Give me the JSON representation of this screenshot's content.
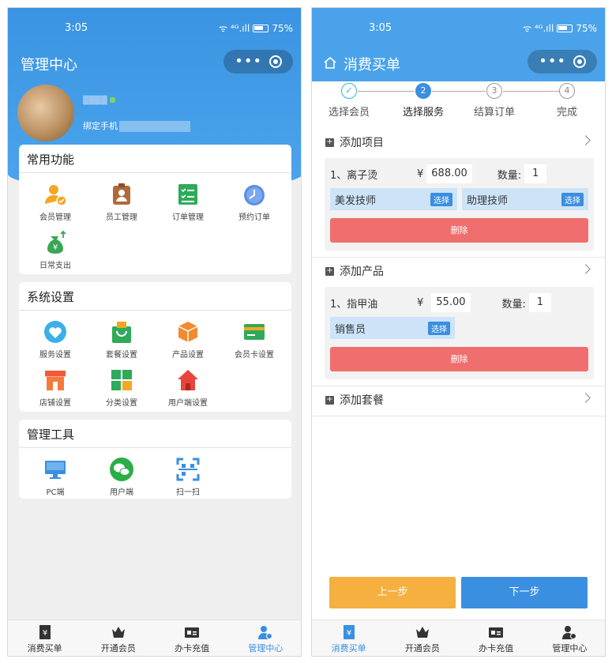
{
  "left": {
    "status": {
      "time": "3:05",
      "battery": "75%",
      "net": "ᯤ ⁴ᴳ.ıll"
    },
    "navbar": {
      "title": "管理中心"
    },
    "profile": {
      "username": "▒▒▒▒",
      "bind_label": "绑定手机"
    },
    "sections": [
      {
        "title": "常用功能",
        "items": [
          {
            "label": "会员管理"
          },
          {
            "label": "员工管理"
          },
          {
            "label": "订单管理"
          },
          {
            "label": "预约订单"
          },
          {
            "label": "日常支出"
          }
        ]
      },
      {
        "title": "系统设置",
        "items": [
          {
            "label": "服务设置"
          },
          {
            "label": "套餐设置"
          },
          {
            "label": "产品设置"
          },
          {
            "label": "会员卡设置"
          },
          {
            "label": "店铺设置"
          },
          {
            "label": "分类设置"
          },
          {
            "label": "用户端设置"
          }
        ]
      },
      {
        "title": "管理工具",
        "items": [
          {
            "label": "PC端"
          },
          {
            "label": "用户端"
          },
          {
            "label": "扫一扫"
          }
        ]
      }
    ],
    "tabs": [
      {
        "label": "消费买单",
        "icon": "receipt-icon"
      },
      {
        "label": "开通会员",
        "icon": "crown-icon"
      },
      {
        "label": "办卡充值",
        "icon": "card-icon"
      },
      {
        "label": "管理中心",
        "icon": "manager-icon",
        "active": true
      }
    ]
  },
  "right": {
    "status": {
      "time": "3:05",
      "battery": "75%",
      "net": "ᯤ ⁴ᴳ.ıll"
    },
    "navbar": {
      "title": "消费买单",
      "icon": "home-icon"
    },
    "steps": [
      {
        "num": "✓",
        "label": "选择会员",
        "state": "done"
      },
      {
        "num": "2",
        "label": "选择服务",
        "state": "current"
      },
      {
        "num": "3",
        "label": "结算订单",
        "state": "todo"
      },
      {
        "num": "4",
        "label": "完成",
        "state": "todo"
      }
    ],
    "add_item": {
      "title": "添加项目",
      "item": {
        "name": "1、离子烫",
        "currency": "¥",
        "price": "688.00",
        "qty_label": "数量:",
        "qty": "1"
      },
      "staff": [
        {
          "role": "美发技师",
          "btn": "选择"
        },
        {
          "role": "助理技师",
          "btn": "选择"
        }
      ],
      "delete": "删除"
    },
    "add_product": {
      "title": "添加产品",
      "item": {
        "name": "1、指甲油",
        "currency": "¥",
        "price": "55.00",
        "qty_label": "数量:",
        "qty": "1"
      },
      "staff": [
        {
          "role": "销售员",
          "btn": "选择"
        }
      ],
      "delete": "删除"
    },
    "add_package": {
      "title": "添加套餐"
    },
    "prev": "上一步",
    "next": "下一步",
    "tabs": [
      {
        "label": "消费买单",
        "icon": "receipt-icon",
        "active": true
      },
      {
        "label": "开通会员",
        "icon": "crown-icon"
      },
      {
        "label": "办卡充值",
        "icon": "card-icon"
      },
      {
        "label": "管理中心",
        "icon": "manager-icon"
      }
    ]
  },
  "colors": {
    "primary": "#4aa3ea",
    "danger": "#f06e6e",
    "prev": "#f5b040",
    "next": "#3a8fe0",
    "chip": "#cde4f8"
  }
}
